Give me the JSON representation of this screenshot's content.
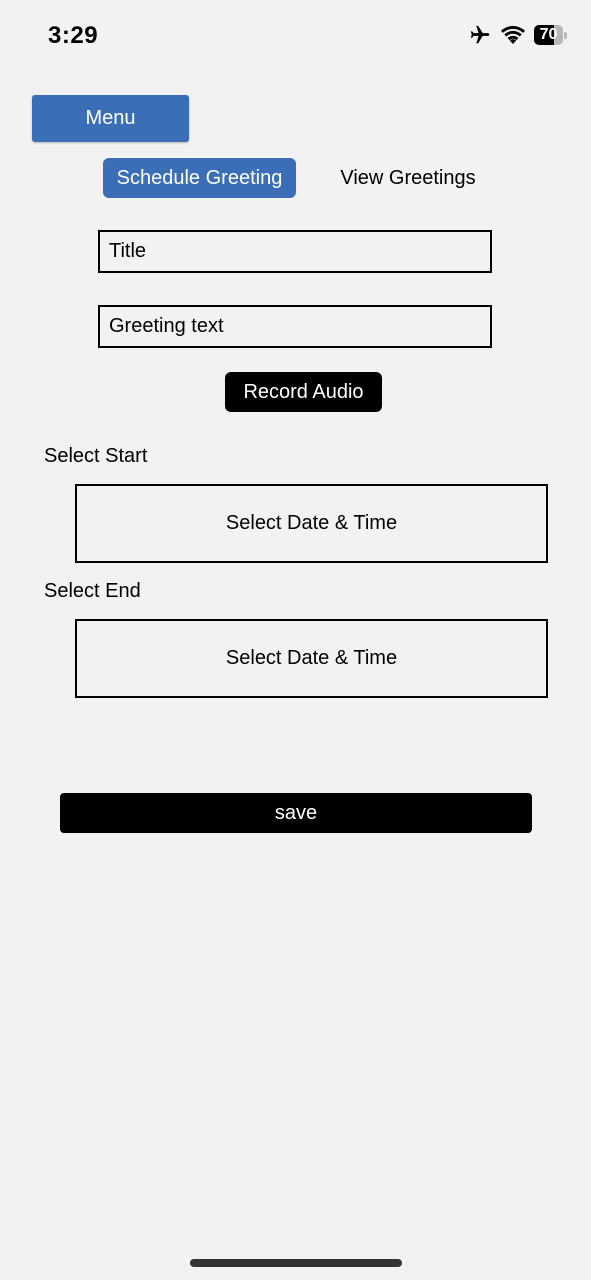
{
  "status_bar": {
    "time": "3:29",
    "battery_level": "70",
    "icons": [
      "airplane-icon",
      "wifi-icon",
      "battery-icon"
    ]
  },
  "menu_label": "Menu",
  "tabs": [
    {
      "label": "Schedule Greeting",
      "active": true
    },
    {
      "label": "View Greetings",
      "active": false
    }
  ],
  "form": {
    "title_placeholder": "Title",
    "title_value": "",
    "greeting_placeholder": "Greeting text",
    "greeting_value": "",
    "record_audio_label": "Record Audio",
    "start_label": "Select Start",
    "start_picker_label": "Select Date & Time",
    "end_label": "Select End",
    "end_picker_label": "Select Date & Time",
    "save_label": "save"
  },
  "colors": {
    "accent": "#3a6fb8",
    "background": "#f2f2f2",
    "button_dark": "#000000"
  }
}
